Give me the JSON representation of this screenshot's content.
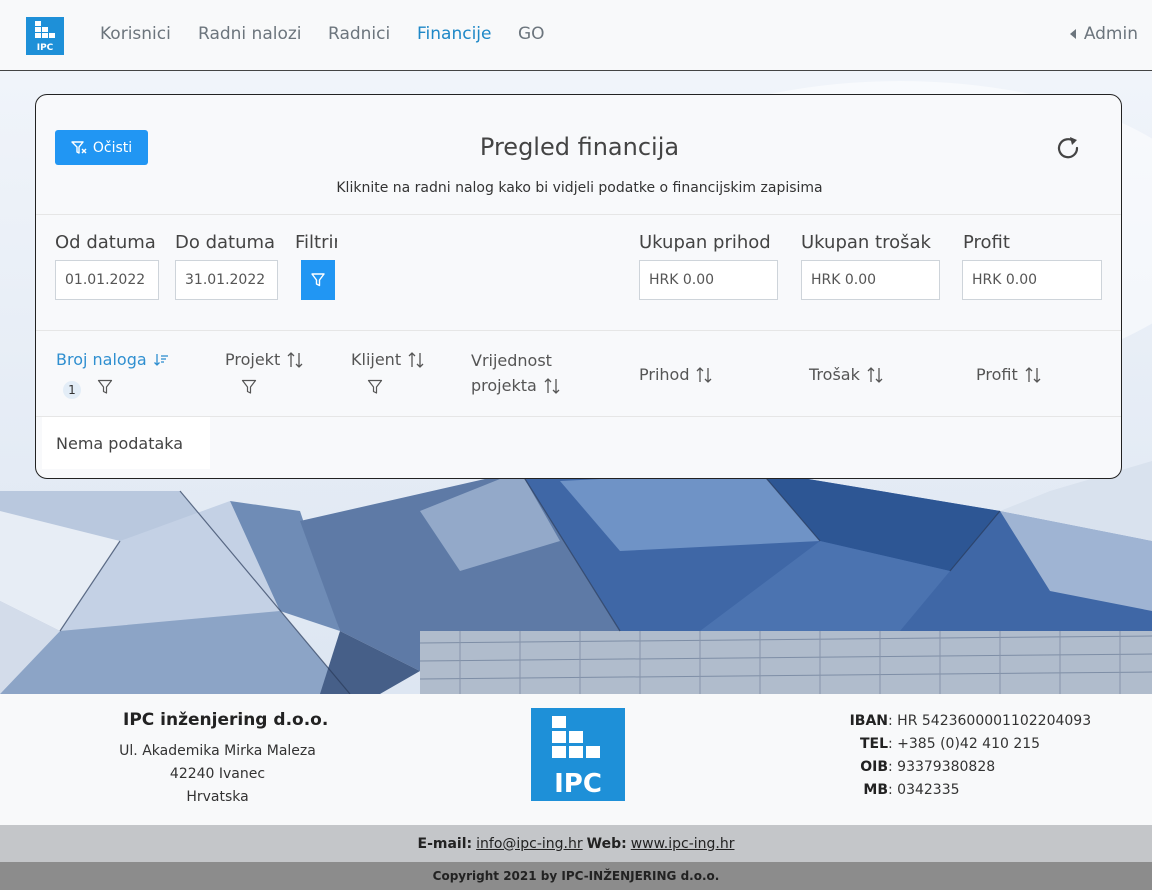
{
  "nav": {
    "logo_text": "IPC",
    "items": [
      "Korisnici",
      "Radni nalozi",
      "Radnici",
      "Financije",
      "GO"
    ],
    "active": "Financije",
    "user": "Admin"
  },
  "card": {
    "clear_button": "Očisti",
    "title": "Pregled financija",
    "subtitle": "Kliknite na radni nalog kako bi vidjeli podatke o financijskim zapisima",
    "filters": {
      "from_label": "Od datuma",
      "from_value": "01.01.2022",
      "to_label": "Do datuma",
      "to_value": "31.01.2022",
      "filter_label": "Filtriraj"
    },
    "totals": {
      "income_label": "Ukupan prihod",
      "income_value": "HRK 0.00",
      "cost_label": "Ukupan trošak",
      "cost_value": "HRK 0.00",
      "profit_label": "Profit",
      "profit_value": "HRK 0.00"
    },
    "table": {
      "columns": [
        "Broj naloga",
        "Projekt",
        "Klijent",
        "Vrijednost",
        "projekta",
        "Prihod",
        "Trošak",
        "Profit"
      ],
      "sort_badge": "1",
      "empty_text": "Nema podataka"
    }
  },
  "footer": {
    "company": "IPC inženjering d.o.o.",
    "address": [
      "Ul. Akademika Mirka Maleza",
      "42240 Ivanec",
      "Hrvatska"
    ],
    "logo_text": "IPC",
    "info": [
      {
        "k": "IBAN",
        "v": "HR 5423600001102204093"
      },
      {
        "k": "TEL",
        "v": "+385 (0)42 410 215"
      },
      {
        "k": "OIB",
        "v": "93379380828"
      },
      {
        "k": "MB",
        "v": "0342335"
      }
    ],
    "email_label": "E-mail:",
    "email": "info@ipc-ing.hr",
    "web_label": "Web:",
    "web": "www.ipc-ing.hr",
    "copyright": "Copyright 2021 by IPC-INŽENJERING d.o.o."
  },
  "colors": {
    "primary": "#2196f3",
    "active_link": "#1e88c7",
    "logo": "#1e90d8"
  },
  "icons": [
    "funnel-icon",
    "refresh-icon",
    "sort-icon",
    "caret-left-icon"
  ]
}
